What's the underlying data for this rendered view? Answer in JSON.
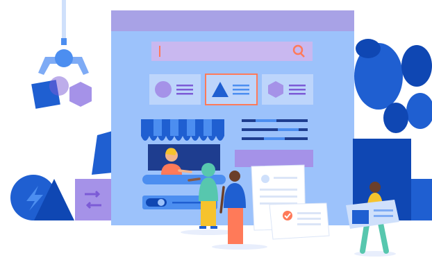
{
  "scene": {
    "search_bar": {
      "placeholder": ""
    },
    "colors": {
      "window_body": "#9cc2fb",
      "window_header": "#a8a2e6",
      "primary_blue": "#1f5fd1",
      "light_blue": "#4c8ef0",
      "purple": "#a592e8",
      "coral": "#ff7a59",
      "yellow": "#f6c32d",
      "teal": "#57c7ae"
    },
    "cards": [
      {
        "shape": "circle-icon"
      },
      {
        "shape": "triangle-icon",
        "selected": true
      },
      {
        "shape": "hexagon-icon"
      }
    ],
    "decor_icons": [
      "robot-claw-icon",
      "lightning-icon",
      "swap-arrows-icon",
      "store-awning-icon",
      "plant-icon",
      "checkmark-icon"
    ]
  }
}
